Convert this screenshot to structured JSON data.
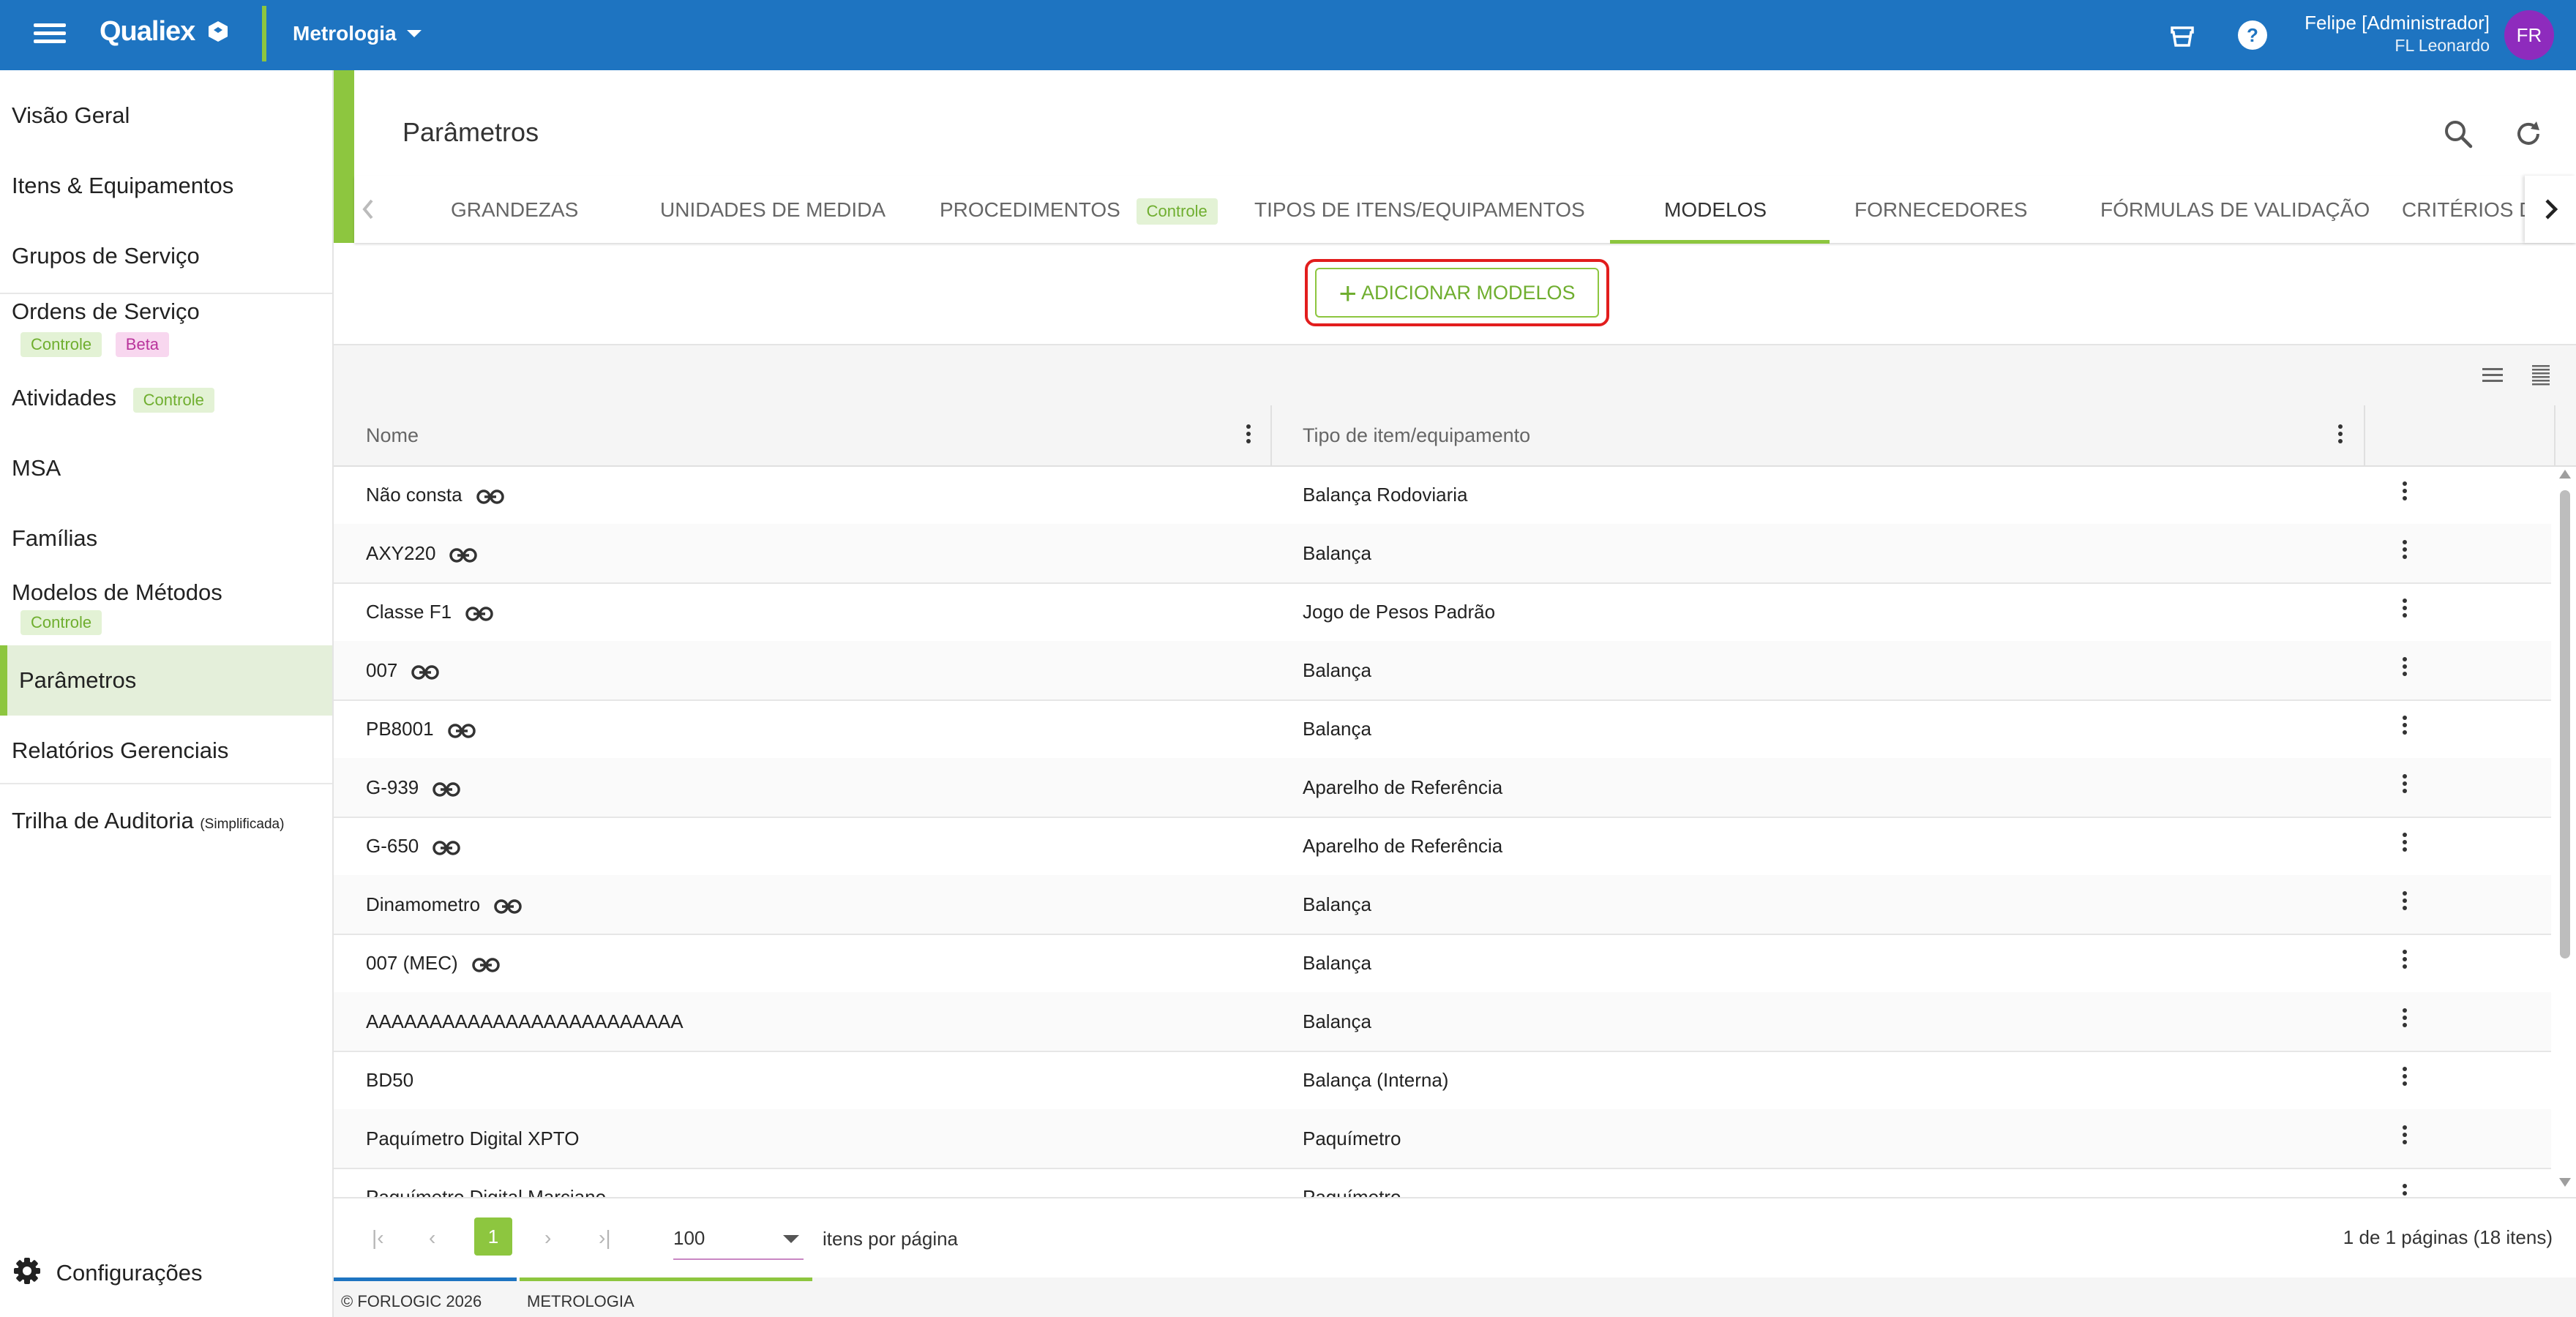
{
  "topbar": {
    "logo": "Qualiex",
    "module": "Metrologia",
    "user_name": "Felipe [Administrador]",
    "user_sub": "FL Leonardo",
    "avatar_initials": "FR",
    "colors": {
      "bar": "#1e74c1",
      "accent": "#8dc63f",
      "avatar": "#8e2bbd"
    }
  },
  "sidebar": {
    "items": [
      {
        "label": "Visão Geral"
      },
      {
        "label": "Itens & Equipamentos"
      },
      {
        "label": "Grupos de Serviço"
      },
      {
        "label": "Ordens de Serviço",
        "badges": [
          "Controle",
          "Beta"
        ]
      },
      {
        "label": "Atividades",
        "badge": "Controle"
      },
      {
        "label": "MSA"
      },
      {
        "label": "Famílias"
      },
      {
        "label": "Modelos de Métodos",
        "badge": "Controle"
      },
      {
        "label": "Parâmetros",
        "active": true
      },
      {
        "label": "Relatórios Gerenciais"
      },
      {
        "label": "Trilha de Auditoria",
        "suffix": "(Simplificada)"
      }
    ],
    "config_label": "Configurações"
  },
  "page": {
    "title": "Parâmetros",
    "icons": [
      "search-icon",
      "refresh-icon"
    ]
  },
  "tabs": {
    "items": [
      {
        "label": "GRANDEZAS"
      },
      {
        "label": "UNIDADES DE MEDIDA"
      },
      {
        "label": "PROCEDIMENTOS",
        "badge": "Controle"
      },
      {
        "label": "TIPOS DE ITENS/EQUIPAMENTOS"
      },
      {
        "label": "MODELOS",
        "active": true
      },
      {
        "label": "FORNECEDORES"
      },
      {
        "label": "FÓRMULAS DE VALIDAÇÃO"
      },
      {
        "label": "CRITÉRIOS D"
      }
    ]
  },
  "add_button": {
    "label": "ADICIONAR MODELOS"
  },
  "table": {
    "columns": [
      "Nome",
      "Tipo de item/equipamento"
    ],
    "rows": [
      {
        "name": "Não consta",
        "type": "Balança Rodoviaria",
        "link": true
      },
      {
        "name": "AXY220",
        "type": "Balança",
        "link": true
      },
      {
        "name": "Classe F1",
        "type": "Jogo de Pesos Padrão",
        "link": true
      },
      {
        "name": "007",
        "type": "Balança",
        "link": true
      },
      {
        "name": "PB8001",
        "type": "Balança",
        "link": true
      },
      {
        "name": "G-939",
        "type": "Aparelho de Referência",
        "link": true
      },
      {
        "name": "G-650",
        "type": "Aparelho de Referência",
        "link": true
      },
      {
        "name": "Dinamometro",
        "type": "Balança",
        "link": true
      },
      {
        "name": "007 (MEC)",
        "type": "Balança",
        "link": true
      },
      {
        "name": "AAAAAAAAAAAAAAAAAAAAAAAAA",
        "type": "Balança",
        "link": false
      },
      {
        "name": "BD50",
        "type": "Balança (Interna)",
        "link": false
      },
      {
        "name": "Paquímetro Digital XPTO",
        "type": "Paquímetro",
        "link": false
      },
      {
        "name": "Paquímetro Digital Marciano",
        "type": "Paquímetro",
        "link": false
      }
    ]
  },
  "pager": {
    "current_page": "1",
    "page_size": "100",
    "page_size_label": "itens por página",
    "info": "1 de 1 páginas (18 itens)"
  },
  "footer": {
    "copyright": "© FORLOGIC 2026",
    "module": "METROLOGIA"
  }
}
